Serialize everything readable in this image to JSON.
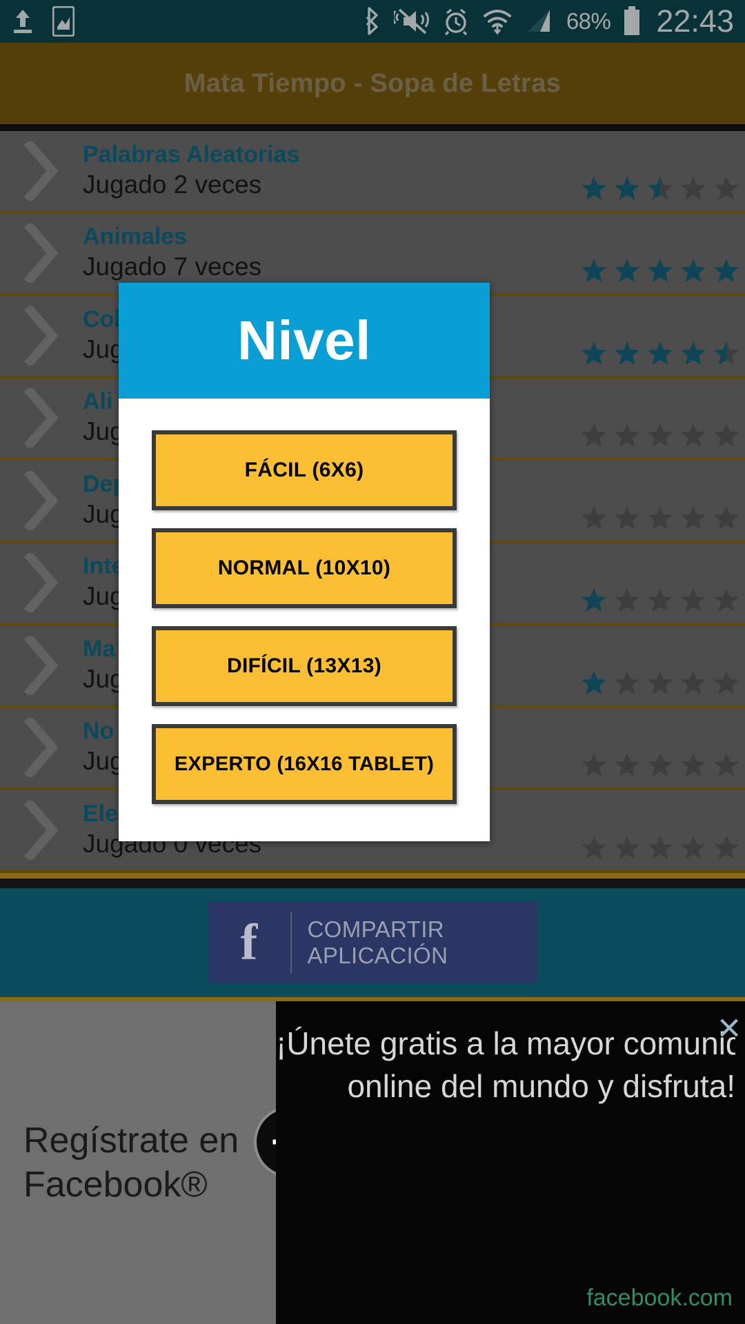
{
  "status_bar": {
    "icons_left": [
      "upload-icon",
      "screenshot-icon"
    ],
    "icons_right": [
      "bluetooth-icon",
      "mute-vibrate-icon",
      "alarm-icon",
      "wifi-icon",
      "signal-icon"
    ],
    "battery_percent": "68%",
    "clock": "22:43"
  },
  "app_bar": {
    "title": "Mata Tiempo - Sopa de Letras"
  },
  "list": {
    "played_prefix": "Jugado",
    "played_suffix": "veces",
    "items": [
      {
        "title": "Palabras Aleatorias",
        "subtitle": "Jugado 2 veces",
        "rating": 2.5
      },
      {
        "title": "Animales",
        "subtitle": "Jugado 7 veces",
        "rating": 5
      },
      {
        "title": "Col",
        "subtitle": "Jug",
        "rating": 4.5
      },
      {
        "title": "Ali",
        "subtitle": "Jug",
        "rating": 0
      },
      {
        "title": "Dep",
        "subtitle": "Jug",
        "rating": 0
      },
      {
        "title": "Inte",
        "subtitle": "Jug",
        "rating": 1
      },
      {
        "title": "Ma",
        "subtitle": "Jug",
        "rating": 1
      },
      {
        "title": "No",
        "subtitle": "Jug",
        "rating": 0
      },
      {
        "title": "Ele",
        "subtitle": "Jugado 0 veces",
        "rating": 0
      }
    ]
  },
  "dialog": {
    "title": "Nivel",
    "buttons": [
      {
        "label": "FÁCIL (6X6)"
      },
      {
        "label": "NORMAL (10X10)"
      },
      {
        "label": "DIFÍCIL (13X13)"
      },
      {
        "label": "EXPERTO (16X16 TABLET)"
      }
    ]
  },
  "footer": {
    "share_label": "COMPARTIR APLICACIÓN",
    "facebook_glyph": "f"
  },
  "ad": {
    "left_line1": "Regístrate en",
    "left_line2": "Facebook®",
    "right_line1": "¡Únete gratis a la mayor comunida",
    "right_line2": "online del mundo y disfruta!",
    "domain": "facebook.com",
    "close_glyph": "×"
  },
  "colors": {
    "status_bar": "#0c4751",
    "app_bar": "#7a5b11",
    "list_bg": "#6f6f6f",
    "row_divider": "#8a6a12",
    "row_title": "#0f6a84",
    "dialog_header": "#0a9fd4",
    "level_button": "#fcbe33",
    "level_button_border": "#3a3a3a",
    "footer_bg": "#0b4c5c",
    "fb_button": "#2a3663",
    "star_filled": "#15657f",
    "star_empty": "#5a5a5a"
  }
}
